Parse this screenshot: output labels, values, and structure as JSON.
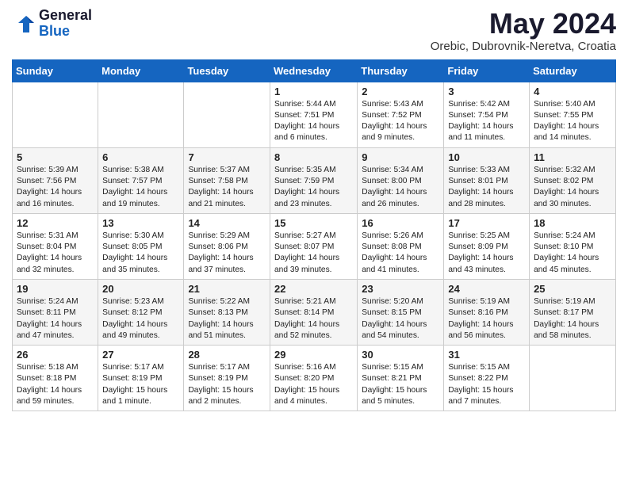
{
  "logo": {
    "general": "General",
    "blue": "Blue"
  },
  "title": "May 2024",
  "location": "Orebic, Dubrovnik-Neretva, Croatia",
  "headers": [
    "Sunday",
    "Monday",
    "Tuesday",
    "Wednesday",
    "Thursday",
    "Friday",
    "Saturday"
  ],
  "weeks": [
    [
      {
        "day": "",
        "info": ""
      },
      {
        "day": "",
        "info": ""
      },
      {
        "day": "",
        "info": ""
      },
      {
        "day": "1",
        "info": "Sunrise: 5:44 AM\nSunset: 7:51 PM\nDaylight: 14 hours\nand 6 minutes."
      },
      {
        "day": "2",
        "info": "Sunrise: 5:43 AM\nSunset: 7:52 PM\nDaylight: 14 hours\nand 9 minutes."
      },
      {
        "day": "3",
        "info": "Sunrise: 5:42 AM\nSunset: 7:54 PM\nDaylight: 14 hours\nand 11 minutes."
      },
      {
        "day": "4",
        "info": "Sunrise: 5:40 AM\nSunset: 7:55 PM\nDaylight: 14 hours\nand 14 minutes."
      }
    ],
    [
      {
        "day": "5",
        "info": "Sunrise: 5:39 AM\nSunset: 7:56 PM\nDaylight: 14 hours\nand 16 minutes."
      },
      {
        "day": "6",
        "info": "Sunrise: 5:38 AM\nSunset: 7:57 PM\nDaylight: 14 hours\nand 19 minutes."
      },
      {
        "day": "7",
        "info": "Sunrise: 5:37 AM\nSunset: 7:58 PM\nDaylight: 14 hours\nand 21 minutes."
      },
      {
        "day": "8",
        "info": "Sunrise: 5:35 AM\nSunset: 7:59 PM\nDaylight: 14 hours\nand 23 minutes."
      },
      {
        "day": "9",
        "info": "Sunrise: 5:34 AM\nSunset: 8:00 PM\nDaylight: 14 hours\nand 26 minutes."
      },
      {
        "day": "10",
        "info": "Sunrise: 5:33 AM\nSunset: 8:01 PM\nDaylight: 14 hours\nand 28 minutes."
      },
      {
        "day": "11",
        "info": "Sunrise: 5:32 AM\nSunset: 8:02 PM\nDaylight: 14 hours\nand 30 minutes."
      }
    ],
    [
      {
        "day": "12",
        "info": "Sunrise: 5:31 AM\nSunset: 8:04 PM\nDaylight: 14 hours\nand 32 minutes."
      },
      {
        "day": "13",
        "info": "Sunrise: 5:30 AM\nSunset: 8:05 PM\nDaylight: 14 hours\nand 35 minutes."
      },
      {
        "day": "14",
        "info": "Sunrise: 5:29 AM\nSunset: 8:06 PM\nDaylight: 14 hours\nand 37 minutes."
      },
      {
        "day": "15",
        "info": "Sunrise: 5:27 AM\nSunset: 8:07 PM\nDaylight: 14 hours\nand 39 minutes."
      },
      {
        "day": "16",
        "info": "Sunrise: 5:26 AM\nSunset: 8:08 PM\nDaylight: 14 hours\nand 41 minutes."
      },
      {
        "day": "17",
        "info": "Sunrise: 5:25 AM\nSunset: 8:09 PM\nDaylight: 14 hours\nand 43 minutes."
      },
      {
        "day": "18",
        "info": "Sunrise: 5:24 AM\nSunset: 8:10 PM\nDaylight: 14 hours\nand 45 minutes."
      }
    ],
    [
      {
        "day": "19",
        "info": "Sunrise: 5:24 AM\nSunset: 8:11 PM\nDaylight: 14 hours\nand 47 minutes."
      },
      {
        "day": "20",
        "info": "Sunrise: 5:23 AM\nSunset: 8:12 PM\nDaylight: 14 hours\nand 49 minutes."
      },
      {
        "day": "21",
        "info": "Sunrise: 5:22 AM\nSunset: 8:13 PM\nDaylight: 14 hours\nand 51 minutes."
      },
      {
        "day": "22",
        "info": "Sunrise: 5:21 AM\nSunset: 8:14 PM\nDaylight: 14 hours\nand 52 minutes."
      },
      {
        "day": "23",
        "info": "Sunrise: 5:20 AM\nSunset: 8:15 PM\nDaylight: 14 hours\nand 54 minutes."
      },
      {
        "day": "24",
        "info": "Sunrise: 5:19 AM\nSunset: 8:16 PM\nDaylight: 14 hours\nand 56 minutes."
      },
      {
        "day": "25",
        "info": "Sunrise: 5:19 AM\nSunset: 8:17 PM\nDaylight: 14 hours\nand 58 minutes."
      }
    ],
    [
      {
        "day": "26",
        "info": "Sunrise: 5:18 AM\nSunset: 8:18 PM\nDaylight: 14 hours\nand 59 minutes."
      },
      {
        "day": "27",
        "info": "Sunrise: 5:17 AM\nSunset: 8:19 PM\nDaylight: 15 hours\nand 1 minute."
      },
      {
        "day": "28",
        "info": "Sunrise: 5:17 AM\nSunset: 8:19 PM\nDaylight: 15 hours\nand 2 minutes."
      },
      {
        "day": "29",
        "info": "Sunrise: 5:16 AM\nSunset: 8:20 PM\nDaylight: 15 hours\nand 4 minutes."
      },
      {
        "day": "30",
        "info": "Sunrise: 5:15 AM\nSunset: 8:21 PM\nDaylight: 15 hours\nand 5 minutes."
      },
      {
        "day": "31",
        "info": "Sunrise: 5:15 AM\nSunset: 8:22 PM\nDaylight: 15 hours\nand 7 minutes."
      },
      {
        "day": "",
        "info": ""
      }
    ]
  ]
}
